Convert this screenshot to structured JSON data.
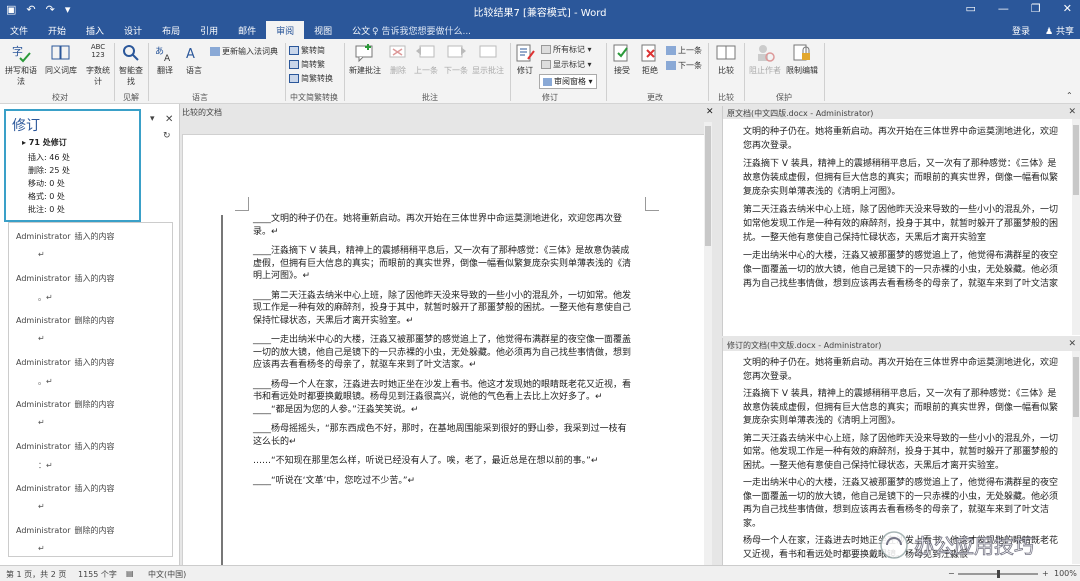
{
  "titlebar": {
    "title": "比较结果7 [兼容模式] - Word",
    "qat_save": "▣",
    "qat_undo": "↶",
    "qat_redo": "↷",
    "qat_more": "▾",
    "min": "—",
    "restore": "❐",
    "close": "✕",
    "ribbon_opts": "▭"
  },
  "tabs": [
    "文件",
    "开始",
    "插入",
    "设计",
    "布局",
    "引用",
    "邮件",
    "审阅",
    "视图",
    "公文"
  ],
  "active_tab": "审阅",
  "tellme": "♀ 告诉我您想要做什么...",
  "signin": "登录",
  "share": "共享",
  "ribbon": {
    "spelling": "拼写和语法",
    "thesaurus": "同义词库",
    "wordcount_top": "ABC\n123",
    "wordcount": "字数统计",
    "smart_lookup": "智能查找",
    "translate": "翻译",
    "language": "语言",
    "update_ime": "更新输入法词典",
    "to_trad": "繁转简",
    "to_simp": "简转繁",
    "convert": "简繁转换",
    "new_comment": "新建批注",
    "delete": "删除",
    "previous": "上一条",
    "next": "下一条",
    "show_comments": "显示批注",
    "track_changes": "修订",
    "all_markup": "所有标记",
    "show_markup": "显示标记",
    "reviewing_pane": "审阅窗格",
    "accept": "接受",
    "reject": "拒绝",
    "prev_change": "上一条",
    "next_change": "下一条",
    "compare": "比较",
    "block_authors": "阻止作者",
    "restrict_editing": "限制编辑",
    "groups": {
      "proofing": "校对",
      "insights": "见解",
      "language": "语言",
      "convert": "中文简繁转换",
      "comments": "批注",
      "tracking": "修订",
      "changes": "更改",
      "compare": "比较",
      "protect": "保护"
    }
  },
  "revisions": {
    "title": "修订",
    "count": "▸ 71 处修订",
    "insertions": "插入: 46 处",
    "deletions": "删除: 25 处",
    "moves": "移动: 0 处",
    "formatting": "格式: 0 处",
    "comments": "批注: 0 处",
    "items": [
      {
        "author": "Administrator",
        "action": "插入的内容",
        "mark": "↵"
      },
      {
        "author": "Administrator",
        "action": "插入的内容",
        "mark": "。↵"
      },
      {
        "author": "Administrator",
        "action": "删除的内容",
        "mark": "↵"
      },
      {
        "author": "Administrator",
        "action": "插入的内容",
        "mark": "。↵"
      },
      {
        "author": "Administrator",
        "action": "删除的内容",
        "mark": "↵"
      },
      {
        "author": "Administrator",
        "action": "插入的内容",
        "mark": "：↵"
      },
      {
        "author": "Administrator",
        "action": "插入的内容",
        "mark": "↵"
      },
      {
        "author": "Administrator",
        "action": "删除的内容",
        "mark": "↵"
      }
    ]
  },
  "compared_doc": {
    "header": "比较的文档",
    "paragraphs": [
      "____文明的种子仍在。她将重新启动。再次开始在三体世界中命运莫测地进化，欢迎您再次登录。↵",
      "____汪淼摘下 V 装具，精神上的震撼稍稍平息后，又一次有了那种感觉：《三体》是故意伪装成虚假，但拥有巨大信息的真实；而眼前的真实世界，倒像一幅看似繁复庞杂实则单薄表浅的《清明上河图》。↵",
      "____第二天汪淼去纳米中心上班，除了因他昨天没来导致的一些小小的混乱外，一切如常。他发现工作是一种有效的麻醉剂，投身于其中，就暂时躲开了那噩梦般的困扰。一整天他有意使自己保持忙碌状态，天黑后才离开实验室。↵",
      "____一走出纳米中心的大楼，汪淼又被那噩梦的感觉追上了，他觉得布满群星的夜空像一面覆盖一切的放大镜，他自己是镜下的一只赤裸的小虫，无处躲藏。他必须再为自己找些事情做，想到应该再去看看杨冬的母亲了，就驱车来到了叶文洁家。↵",
      "____杨母一个人在家，汪淼进去时她正坐在沙发上看书。他这才发现她的眼睛既老花又近视，看书和看远处时都要换戴眼镜。杨母见到汪淼很高兴，说他的气色看上去比上次好多了。↵ ____“都是因为您的人参。”汪淼笑笑说。↵",
      "____杨母摇摇头，“那东西成色不好，那时，在基地周围能采到很好的野山参，我采到过一枝有这么长的↵",
      "……“不知现在那里怎么样，听说已经没有人了。唉，老了，最近总是在想以前的事。”↵",
      "____“听说在‘文革’中，您吃过不少苦。”↵"
    ]
  },
  "original_doc": {
    "header": "原文档(中文四版.docx - Administrator)",
    "paragraphs": [
      "文明的种子仍在。她将重新启动。再次开始在三体世界中命运莫测地进化，欢迎您再次登录。",
      "汪淼摘下 V 装具，精神上的震撼稍稍平息后，又一次有了那种感觉：《三体》是故意伪装成虚假，但拥有巨大信息的真实；而眼前的真实世界，倒像一幅看似繁复庞杂实则单薄表浅的《清明上河图》。",
      "第二天汪淼去纳米中心上班，除了因他昨天没来导致的一些小小的混乱外，一切如常他发现工作是一种有效的麻醉剂，投身于其中，就暂时躲开了那噩梦般的困扰。一整天他有意使自己保持忙碌状态，天黑后才离开实验室",
      "一走出纳米中心的大楼，汪淼又被那噩梦的感觉追上了，他觉得布满群星的夜空像一面覆盖一切的放大镜，他自己是镜下的一只赤裸的小虫，无处躲藏。他必须再为自己找些事情做，想到应该再去看看杨冬的母亲了，就驱车来到了叶文洁家"
    ]
  },
  "revised_doc": {
    "header": "修订的文档(中文版.docx - Administrator)",
    "paragraphs": [
      "文明的种子仍在。她将重新启动。再次开始在三体世界中命运莫测地进化，欢迎您再次登录。",
      "汪淼摘下 V 装具，精神上的震撼稍稍平息后，又一次有了那种感觉：《三体》是故意伪装成虚假，但拥有巨大信息的真实；而眼前的真实世界，倒像一幅看似繁复庞杂实则单薄表浅的《清明上河图》。",
      "第二天汪淼去纳米中心上班，除了因他昨天没来导致的一些小小的混乱外，一切如常。他发现工作是一种有效的麻醉剂，投身于其中，就暂时躲开了那噩梦般的困扰。一整天他有意使自己保持忙碌状态，天黑后才离开实验室。",
      "一走出纳米中心的大楼，汪淼又被那噩梦的感觉追上了，他觉得布满群星的夜空像一面覆盖一切的放大镜，他自己是镜下的一只赤裸的小虫，无处躲藏。他必须再为自己找些事情做，想到应该再去看看杨冬的母亲了，就驱车来到了叶文洁家。",
      "杨母一个人在家，汪淼进去时她正坐在沙发上看书。他这才发现她的眼睛既老花又近视，看书和看远处时都要换戴眼镜。杨母见到汪淼很"
    ]
  },
  "status": {
    "page": "第 1 页，共 2 页",
    "words": "1155 个字",
    "language": "中文(中国)",
    "zoom": "100%",
    "zoom_level": 0.5
  },
  "watermark": "办公应用技巧",
  "colors": {
    "brand": "#2b579a",
    "highlight": "#3aa0c8"
  }
}
